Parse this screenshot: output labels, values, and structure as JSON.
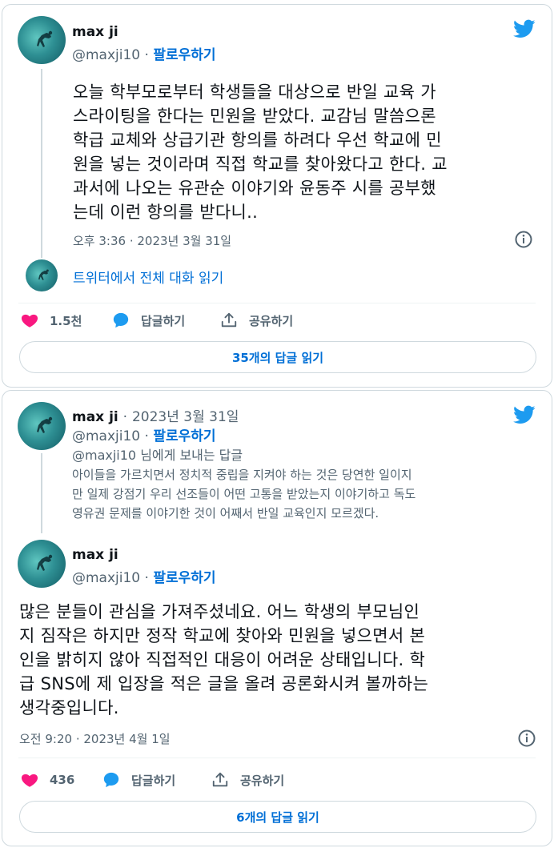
{
  "tweet1": {
    "author_name": "max ji",
    "author_handle": "@maxji10",
    "follow_label": "팔로우하기",
    "separator": "·",
    "body_lines": [
      "오늘 학부모로부터 학생들을 대상으로 반일 교육 가",
      "스라이팅을 한다는 민원을 받았다. 교감님 말씀으론",
      "학급 교체와 상급기관 항의를 하려다 우선 학교에 민",
      "원을 넣는 것이라며 직접 학교를 찾아왔다고 한다. 교",
      "과서에 나오는 유관순 이야기와 윤동주 시를 공부했",
      "는데 이런 항의를 받다니.."
    ],
    "timestamp": "오후 3:36 · 2023년 3월 31일",
    "read_thread_label": "트위터에서 전체 대화 읽기",
    "likes": "1.5천",
    "reply_label": "답글하기",
    "share_label": "공유하기",
    "read_replies_label": "35개의 답글 읽기"
  },
  "tweet2": {
    "parent": {
      "author_name": "max ji",
      "date": "2023년 3월 31일",
      "author_handle": "@maxji10",
      "follow_label": "팔로우하기",
      "reply_to": "@maxji10 님에게 보내는 답글",
      "body_lines": [
        "아이들을 가르치면서 정치적 중립을 지켜야 하는 것은 당연한 일이지",
        "만 일제 강점기 우리 선조들이 어떤 고통을 받았는지 이야기하고 독도",
        "영유권 문제를 이야기한 것이 어째서 반일 교육인지 모르겠다."
      ]
    },
    "author_name": "max ji",
    "author_handle": "@maxji10",
    "follow_label": "팔로우하기",
    "separator": "·",
    "body_lines": [
      "많은 분들이 관심을 가져주셨네요. 어느 학생의 부모님인",
      "지 짐작은 하지만 정작 학교에 찾아와 민원을 넣으면서 본",
      "인을 밝히지 않아 직접적인 대응이 어려운 상태입니다. 학",
      "급 SNS에 제 입장을 적은 글을 올려 공론화시켜 볼까하는",
      "생각중입니다."
    ],
    "timestamp": "오전 9:20 · 2023년 4월 1일",
    "likes": "436",
    "reply_label": "답글하기",
    "share_label": "공유하기",
    "read_replies_label": "6개의 답글 읽기"
  },
  "colors": {
    "link": "#006fd6",
    "like": "#f91880",
    "reply": "#1d9bf0",
    "secondary_text": "#536471",
    "border": "#cfd9de"
  },
  "icons": [
    "twitter-bird-icon",
    "info-icon",
    "heart-icon",
    "reply-bubble-icon",
    "share-icon"
  ]
}
